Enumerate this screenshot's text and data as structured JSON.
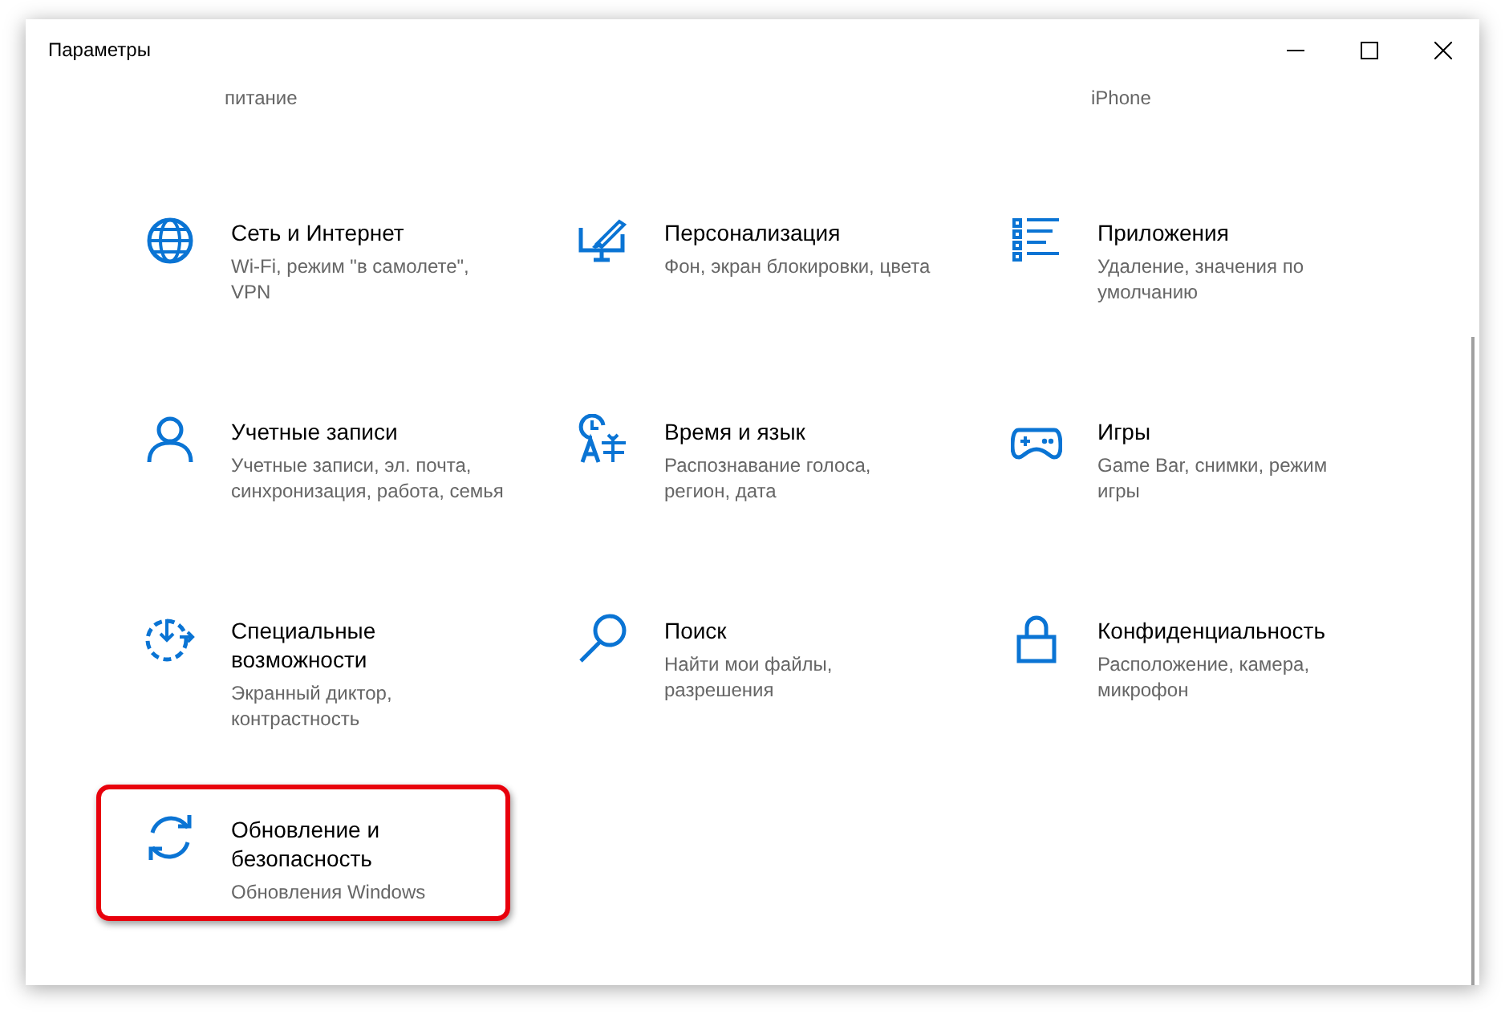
{
  "window": {
    "title": "Параметры"
  },
  "cut_row": [
    {
      "description": "питание"
    },
    {
      "description": "iPhone"
    }
  ],
  "categories": [
    {
      "title": "Сеть и Интернет",
      "description": "Wi-Fi, режим \"в самолете\", VPN",
      "highlighted": false
    },
    {
      "title": "Персонализация",
      "description": "Фон, экран блокировки, цвета",
      "highlighted": false
    },
    {
      "title": "Приложения",
      "description": "Удаление, значения по умолчанию",
      "highlighted": false
    },
    {
      "title": "Учетные записи",
      "description": "Учетные записи, эл. почта, синхронизация, работа, семья",
      "highlighted": false
    },
    {
      "title": "Время и язык",
      "description": "Распознавание голоса, регион, дата",
      "highlighted": false
    },
    {
      "title": "Игры",
      "description": "Game Bar, снимки, режим игры",
      "highlighted": false
    },
    {
      "title": "Специальные возможности",
      "description": "Экранный диктор, контрастность",
      "highlighted": false
    },
    {
      "title": "Поиск",
      "description": "Найти мои файлы, разрешения",
      "highlighted": false
    },
    {
      "title": "Конфиденциальность",
      "description": "Расположение, камера, микрофон",
      "highlighted": false
    },
    {
      "title": "Обновление и безопасность",
      "description": "Обновления Windows",
      "highlighted": true
    }
  ]
}
